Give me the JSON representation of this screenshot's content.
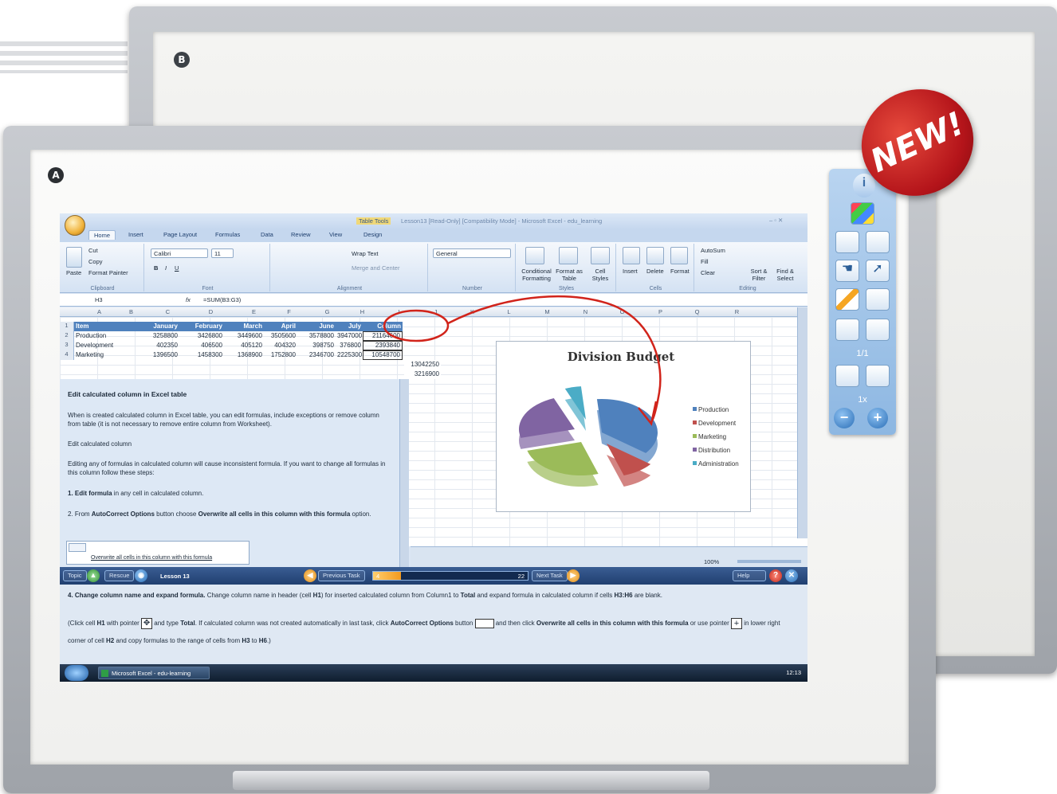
{
  "labels": {
    "board_a": "A",
    "board_b": "B",
    "new_badge": "NEW!"
  },
  "colors": {
    "accent": "#4f81bd",
    "nav": "#203f70",
    "seal": "#c0161b"
  },
  "toolpanel": {
    "page_indicator": "1/1",
    "zoom_indicator": "1x",
    "icons": [
      "info-icon",
      "windows-icon",
      "window-icon",
      "screen-icon",
      "hand-icon",
      "pointer-icon",
      "pen-icon",
      "eraser-icon",
      "capture-icon",
      "new-page-icon",
      "prev-page-icon",
      "next-page-icon",
      "zoom-out-icon",
      "zoom-in-icon"
    ]
  },
  "excel": {
    "window_title": "Lesson13 [Read-Only] [Compatibility Mode] - Microsoft Excel - edu_learning",
    "table_tools": "Table Tools",
    "tabs": [
      "Home",
      "Insert",
      "Page Layout",
      "Formulas",
      "Data",
      "Review",
      "View",
      "Design"
    ],
    "ribbon": {
      "clipboard": {
        "label": "Clipboard",
        "paste": "Paste",
        "cut": "Cut",
        "copy": "Copy",
        "format_painter": "Format Painter"
      },
      "font": {
        "label": "Font",
        "name": "Calibri",
        "size": "11"
      },
      "alignment": {
        "label": "Alignment",
        "wrap": "Wrap Text",
        "merge": "Merge and Center"
      },
      "number": {
        "label": "Number",
        "format": "General"
      },
      "styles": {
        "label": "Styles",
        "conditional": "Conditional Formatting",
        "format_table": "Format as Table",
        "cell_styles": "Cell Styles"
      },
      "cells": {
        "label": "Cells",
        "insert": "Insert",
        "delete": "Delete",
        "format": "Format"
      },
      "editing": {
        "label": "Editing",
        "autosum": "AutoSum",
        "fill": "Fill",
        "clear": "Clear",
        "sort": "Sort & Filter",
        "find": "Find & Select"
      }
    },
    "name_box": "H3",
    "formula": "=SUM(B3:G3)",
    "columns": [
      "A",
      "B",
      "C",
      "D",
      "E",
      "F",
      "G",
      "H",
      "I",
      "J",
      "K",
      "L",
      "M",
      "N",
      "O",
      "P",
      "Q",
      "R"
    ],
    "table": {
      "headers": [
        "Item",
        "January",
        "February",
        "March",
        "April",
        "June",
        "July",
        "Column"
      ],
      "rows": [
        {
          "num": "2",
          "cells": [
            "Production",
            "3258800",
            "3426800",
            "3449600",
            "3505600",
            "3578800",
            "3947000",
            "21164600"
          ]
        },
        {
          "num": "3",
          "cells": [
            "Development",
            "402350",
            "406500",
            "405120",
            "404320",
            "398750",
            "376800",
            "2393840"
          ]
        },
        {
          "num": "4",
          "cells": [
            "Marketing",
            "1396500",
            "1458300",
            "1368900",
            "1752800",
            "2346700",
            "2225300",
            "10548700"
          ]
        }
      ],
      "partial_h": [
        "13042250",
        "3216900"
      ]
    },
    "chart_data": {
      "type": "pie",
      "title": "Division Budget",
      "categories": [
        "Production",
        "Development",
        "Marketing",
        "Distribution",
        "Administration"
      ],
      "colors": [
        "#4f81bd",
        "#c0504d",
        "#9bbb59",
        "#8064a2",
        "#4bacc6"
      ]
    },
    "help": {
      "title": "Edit calculated column in Excel table",
      "p1": "When is created calculated column in Excel table, you can edit formulas, include exceptions or remove column from table (it is not necessary to remove entire column from Worksheet).",
      "p2": "Edit calculated column",
      "p3": "Editing any of formulas in calculated column will cause inconsistent formula. If you want to change all formulas in this column follow these steps:",
      "s1b": "1. Edit formula",
      "s1": " in any cell in calculated column.",
      "s2a": "2. From ",
      "s2b": "AutoCorrect Options",
      "s2c": " button choose ",
      "s2d": "Overwrite all cells in this column with this formula",
      "s2e": " option.",
      "popup": "Overwrite all cells in this column with this formula"
    },
    "status": {
      "zoom": "100%"
    },
    "nav": {
      "topic": "Topic",
      "rescue": "Rescue",
      "lesson": "Lesson 13",
      "previous": "Previous Task",
      "progress_start": "4",
      "progress_end": "22",
      "next": "Next Task",
      "help": "Help",
      "progress": 0.18
    },
    "task": {
      "b1": "4. Change column name and expand formula.",
      "t1": " Change column name in header (cell ",
      "b2": "H1",
      "t2": ") for inserted calculated column from Column1 to ",
      "b3": "Total",
      "t3": " and expand formula in calculated column if cells ",
      "b4": "H3:H6",
      "t4": " are blank.",
      "t5": "(Click cell ",
      "b5": "H1",
      "t6": " with pointer ",
      "t7": " and type ",
      "b6": "Total",
      "t8": ". If calculated column was not created automatically in last task, click ",
      "b7": "AutoCorrect Options",
      "t9": " button ",
      "t10": " and then click ",
      "b8": "Overwrite all cells in this column with this formula",
      "t11": " or use pointer ",
      "t12": " in lower right corner of cell ",
      "b9": "H2",
      "t13": " and copy formulas to the range of cells from ",
      "b10": "H3",
      "t14": " to ",
      "b11": "H6",
      "t15": ".)"
    },
    "taskbar": {
      "app": "Microsoft Excel - edu-learning",
      "time": "12:13"
    }
  }
}
